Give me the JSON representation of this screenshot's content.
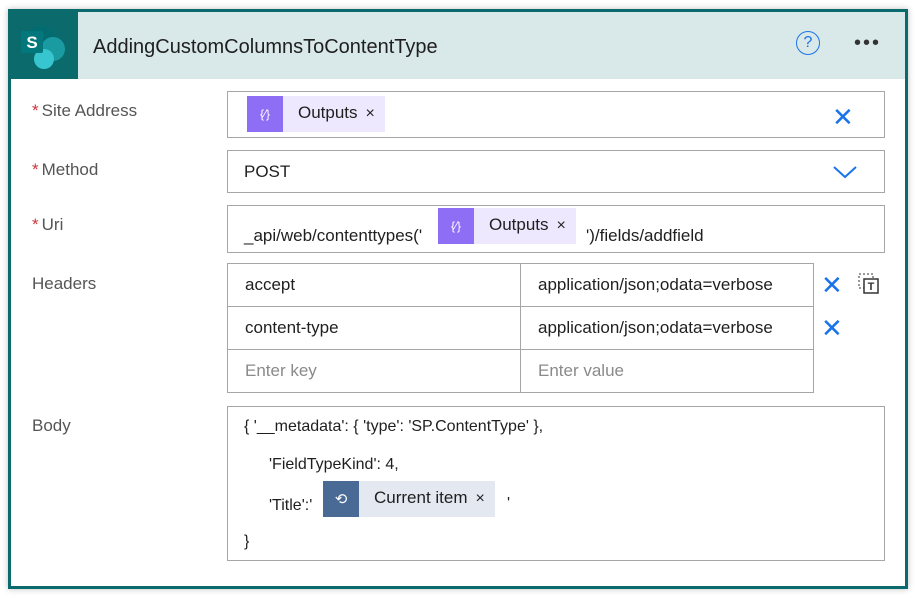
{
  "header": {
    "title": "AddingCustomColumnsToContentType",
    "logo_letter": "S",
    "help_icon": "question-circle-icon",
    "more_icon": "ellipsis-icon"
  },
  "colors": {
    "accent": "#0b6a6b",
    "header_bg": "#d9e8e8",
    "link": "#1a73e8",
    "expression_token": "#8f6ef6",
    "loop_token": "#4a6a96"
  },
  "fields": {
    "site_address": {
      "label": "Site Address",
      "required_mark": "*",
      "token": "Outputs"
    },
    "method": {
      "label": "Method",
      "required_mark": "*",
      "value": "POST"
    },
    "uri": {
      "label": "Uri",
      "required_mark": "*",
      "prefix": "_api/web/contenttypes('",
      "token": "Outputs",
      "suffix": "')/fields/addfield"
    },
    "headers": {
      "label": "Headers",
      "rows": [
        {
          "key": "accept",
          "value": "application/json;odata=verbose"
        },
        {
          "key": "content-type",
          "value": "application/json;odata=verbose"
        }
      ],
      "key_placeholder": "Enter key",
      "value_placeholder": "Enter value"
    },
    "body": {
      "label": "Body",
      "line1": "{ '__metadata': { 'type': 'SP.ContentType' },",
      "line2": "'FieldTypeKind': 4,",
      "line3_prefix": "'Title':'",
      "token": "Current item",
      "line3_suffix": "'",
      "line4": "}"
    }
  },
  "token_close": "×"
}
